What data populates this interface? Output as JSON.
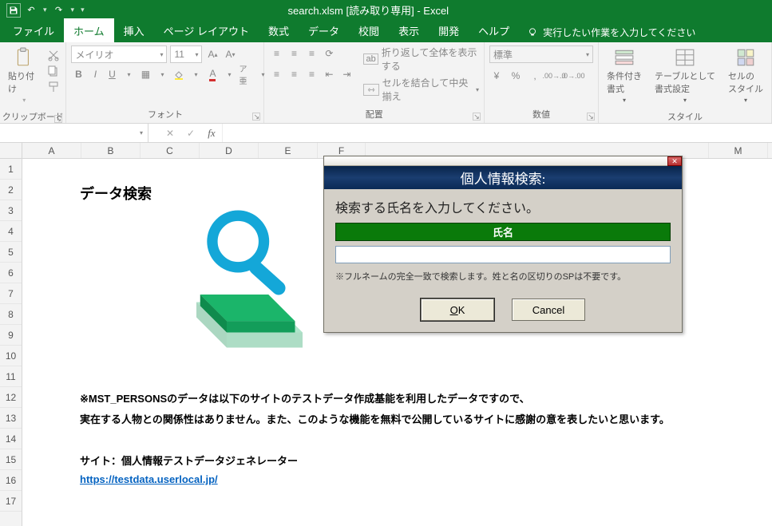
{
  "title": "search.xlsm  [読み取り専用]  -  Excel",
  "menu": {
    "file": "ファイル",
    "home": "ホーム",
    "insert": "挿入",
    "page_layout": "ページ レイアウト",
    "formulas": "数式",
    "data": "データ",
    "review": "校閲",
    "view": "表示",
    "developer": "開発",
    "help": "ヘルプ",
    "tell_me": "実行したい作業を入力してください"
  },
  "ribbon": {
    "clipboard": {
      "label": "クリップボード",
      "paste": "貼り付け"
    },
    "font": {
      "label": "フォント",
      "name": "メイリオ",
      "size": "11"
    },
    "alignment": {
      "label": "配置",
      "wrap": "折り返して全体を表示する",
      "merge": "セルを結合して中央揃え"
    },
    "number": {
      "label": "数値",
      "format": "標準"
    },
    "styles": {
      "label": "スタイル",
      "conditional": "条件付き\n書式",
      "table": "テーブルとして\n書式設定",
      "cell": "セルの\nスタイル"
    }
  },
  "formula_bar": {
    "name_box": ""
  },
  "columns": [
    "A",
    "B",
    "C",
    "D",
    "E",
    "F",
    "",
    "M"
  ],
  "rows": [
    "1",
    "2",
    "3",
    "4",
    "5",
    "6",
    "7",
    "8",
    "9",
    "10",
    "11",
    "12",
    "13",
    "14",
    "15",
    "16",
    "17"
  ],
  "sheet": {
    "heading": "データ検索",
    "line12": "※MST_PERSONSのデータは以下のサイトのテストデータ作成基能を利用したデータですので、",
    "line13": "実在する人物との関係性はありません。また、このような機能を無料で公開しているサイトに感謝の意を表したいと思います。",
    "line15": "サイト：個人情報テストデータジェネレーター",
    "line16": "https://testdata.userlocal.jp/"
  },
  "dialog": {
    "title": "個人情報検索:",
    "prompt": "検索する氏名を入力してください。",
    "field_label": "氏名",
    "input_value": "",
    "note": "※フルネームの完全一致で検索します。姓と名の区切りのSPは不要です。",
    "ok": "OK",
    "cancel": "Cancel"
  }
}
